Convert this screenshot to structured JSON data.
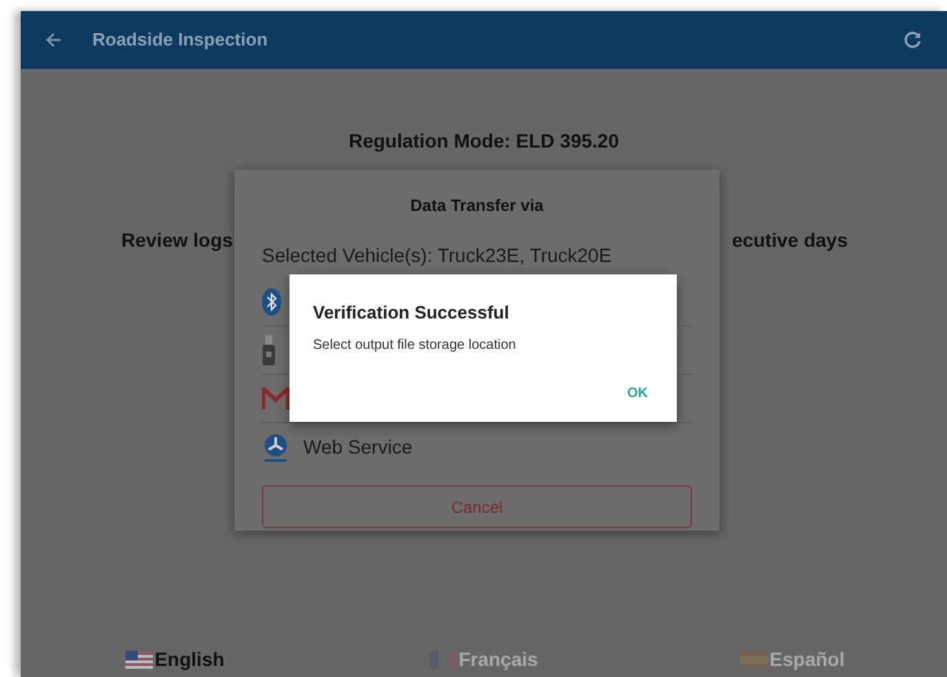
{
  "app_bar": {
    "title": "Roadside Inspection"
  },
  "regulation_mode": "Regulation Mode: ELD 395.20",
  "background_texts": [
    "Review logs",
    "ecutive days"
  ],
  "transfer_dialog": {
    "title": "Data Transfer via",
    "selected_vehicles": "Selected Vehicle(s): Truck23E, Truck20E",
    "options": [
      {
        "kind": "bluetooth"
      },
      {
        "kind": "usb"
      },
      {
        "kind": "email"
      },
      {
        "kind": "web_service",
        "label": "Web Service"
      }
    ],
    "cancel": "Cancel"
  },
  "alert": {
    "title": "Verification Successful",
    "message": "Select output file storage location",
    "ok": "OK"
  },
  "languages": [
    {
      "kind": "us",
      "label": "English",
      "selected": true
    },
    {
      "kind": "fr",
      "label": "Français",
      "selected": false
    },
    {
      "kind": "es",
      "label": "Español",
      "selected": false
    }
  ]
}
